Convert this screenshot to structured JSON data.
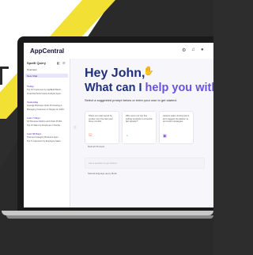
{
  "app": {
    "brand": "AppCentral",
    "top_icons": [
      "settings-icon",
      "bell-icon",
      "user-icon"
    ]
  },
  "sidebar": {
    "header": "Spotfi Query",
    "links": [
      "Overview",
      "New Chat"
    ],
    "sections": [
      {
        "label": "Today",
        "items": [
          "Top 10 Customers by AppBuild Batch...",
          "Financial Performance Analysis Apps..."
        ]
      },
      {
        "label": "Yesterday",
        "items": [
          "Average Business Order Processing A...",
          "Managing Customers & Targets for 2023..."
        ]
      },
      {
        "label": "Last 7 Days",
        "items": [
          "Q2 Revenue Metrics and Order Profits",
          "Top 10 Sales by Employee in Northe..."
        ]
      },
      {
        "label": "Last 30 Days",
        "items": [
          "Total and Category Business Apps...",
          "Top 5 Customers by Employee Sales..."
        ]
      }
    ]
  },
  "main": {
    "greeting": "Hey John,",
    "headline_pre": "What can I ",
    "headline_em": "help you with?",
    "subtitle": "Select a suggested prompt below or enter your own to get started.",
    "cards": [
      {
        "text": "Show me total spend by vendor over the last year three months",
        "icon": "receipt-icon",
        "color": "#e06a35"
      },
      {
        "text": "Who were our top five selling products to America last quarter?",
        "icon": "chart-icon",
        "color": "#3aa0d6"
      },
      {
        "text": "Assess sales closing items and suggest foundation to promotion strategies",
        "icon": "calendar-icon",
        "color": "#7b4dd9"
      }
    ],
    "refresh_label": "Refresh Prompts",
    "input_placeholder": "Ask a question to get started",
    "language_label": "Natural language query Mode"
  }
}
